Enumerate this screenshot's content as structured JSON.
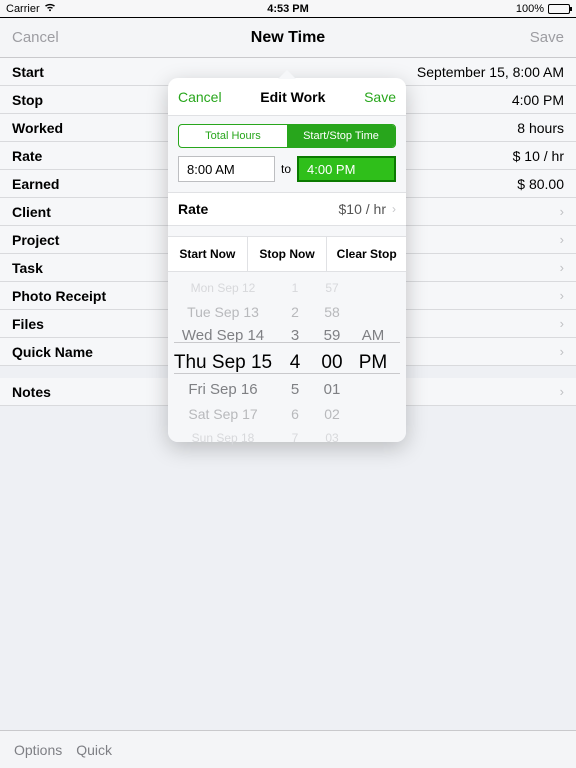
{
  "statusbar": {
    "carrier": "Carrier",
    "time": "4:53 PM",
    "battery": "100%"
  },
  "navbar": {
    "cancel": "Cancel",
    "title": "New Time",
    "save": "Save"
  },
  "rows": {
    "start": {
      "label": "Start",
      "value": "September 15,  8:00 AM"
    },
    "stop": {
      "label": "Stop",
      "value": "4:00 PM"
    },
    "worked": {
      "label": "Worked",
      "value": "8 hours"
    },
    "rate": {
      "label": "Rate",
      "value": "$ 10 / hr"
    },
    "earned": {
      "label": "Earned",
      "value": "$ 80.00"
    },
    "client": {
      "label": "Client"
    },
    "project": {
      "label": "Project"
    },
    "task": {
      "label": "Task"
    },
    "photo": {
      "label": "Photo Receipt"
    },
    "files": {
      "label": "Files"
    },
    "quick": {
      "label": "Quick Name"
    },
    "notes": {
      "label": "Notes"
    }
  },
  "toolbar": {
    "options": "Options",
    "quick": "Quick"
  },
  "popover": {
    "cancel": "Cancel",
    "title": "Edit Work",
    "save": "Save",
    "seg": {
      "a": "Total Hours",
      "b": "Start/Stop Time"
    },
    "startTime": "8:00 AM",
    "to": "to",
    "stopTime": "4:00 PM",
    "rateLabel": "Rate",
    "rateValue": "$10 / hr",
    "btns": {
      "a": "Start Now",
      "b": "Stop Now",
      "c": "Clear Stop"
    },
    "picker": {
      "dates": [
        "Mon Sep 12",
        "Tue Sep 13",
        "Wed Sep 14",
        "Thu Sep 15",
        "Fri Sep 16",
        "Sat Sep 17",
        "Sun Sep 18"
      ],
      "hours": [
        "1",
        "2",
        "3",
        "4",
        "5",
        "6",
        "7"
      ],
      "mins": [
        "57",
        "58",
        "59",
        "00",
        "01",
        "02",
        "03"
      ],
      "ampm": [
        "AM",
        "PM"
      ]
    }
  }
}
